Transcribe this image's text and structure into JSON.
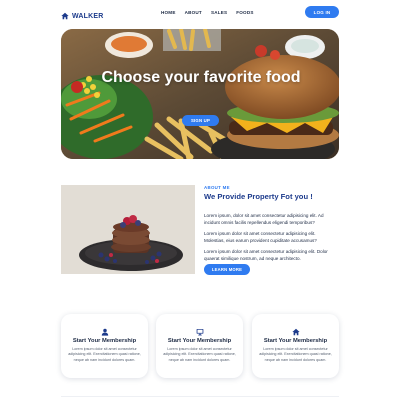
{
  "brand": {
    "name": "WALKER",
    "icon": "home-icon",
    "color": "#1d3b8c"
  },
  "nav": {
    "items": [
      "HOME",
      "ABOUT",
      "SALES",
      "FOODS"
    ],
    "login_label": "LOG IN"
  },
  "hero": {
    "title": "Choose your favorite food",
    "signup_label": "SIGN UP"
  },
  "about": {
    "kicker": "ABOUT ME",
    "title": "We Provide Property Fot you !",
    "paragraphs": [
      "Lorem ipsum, dolor sit amet consectetur adipisicing elit. Ad incidunt omnis facilis repellendus eligendi temporibus?",
      "Lorem ipsum dolor sit amet consectetur adipisicing elit. Molestias, eius earum provident cupiditate accusamus?",
      "Lorem ipsum dolor sit amet consectetur adipisicing elit. Dolor quaerat similique nostrum, ad neque architecto."
    ],
    "button_label": "LEARN MORE"
  },
  "cards": [
    {
      "icon": "user-icon",
      "title": "Start Your Membership",
      "text": "Lorem ipsum dolor sit amet consectetur adipisicing elit. Exercitationem quasi ratione, neque ab nam incidunt dolores quam."
    },
    {
      "icon": "monitor-icon",
      "title": "Start Your Membership",
      "text": "Lorem ipsum dolor sit amet consectetur adipisicing elit. Exercitationem quasi ratione, neque ab nam incidunt dolores quam."
    },
    {
      "icon": "home-icon",
      "title": "Start Your Membership",
      "text": "Lorem ipsum dolor sit amet consectetur adipisicing elit. Exercitationem quasi ratione, neque ab nam incidunt dolores quam."
    }
  ],
  "colors": {
    "accent": "#2f7bf0",
    "heading": "#1d3b8c"
  }
}
